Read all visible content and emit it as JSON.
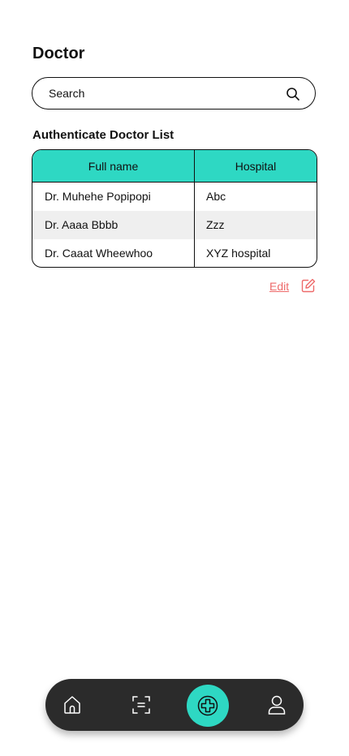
{
  "page": {
    "title": "Doctor"
  },
  "search": {
    "placeholder": "Search",
    "icon": "search-icon"
  },
  "section": {
    "title": "Authenticate Doctor List"
  },
  "table": {
    "columns": [
      "Full name",
      "Hospital"
    ],
    "rows": [
      {
        "name": "Dr. Muhehe Popipopi",
        "hospital": "Abc"
      },
      {
        "name": "Dr. Aaaa Bbbb",
        "hospital": "Zzz"
      },
      {
        "name": "Dr. Caaat Wheewhoo",
        "hospital": "XYZ hospital"
      }
    ]
  },
  "actions": {
    "edit_label": "Edit",
    "edit_icon": "edit-icon"
  },
  "nav": {
    "items": [
      {
        "icon": "home-icon"
      },
      {
        "icon": "scan-icon"
      },
      {
        "icon": "medical-cross-icon",
        "active": true
      },
      {
        "icon": "user-icon"
      }
    ]
  },
  "colors": {
    "accent": "#2ED8C3",
    "link": "#EE6A6A",
    "nav_background": "#2B2B2B",
    "row_alt": "#EFEFEF",
    "text": "#111111"
  }
}
